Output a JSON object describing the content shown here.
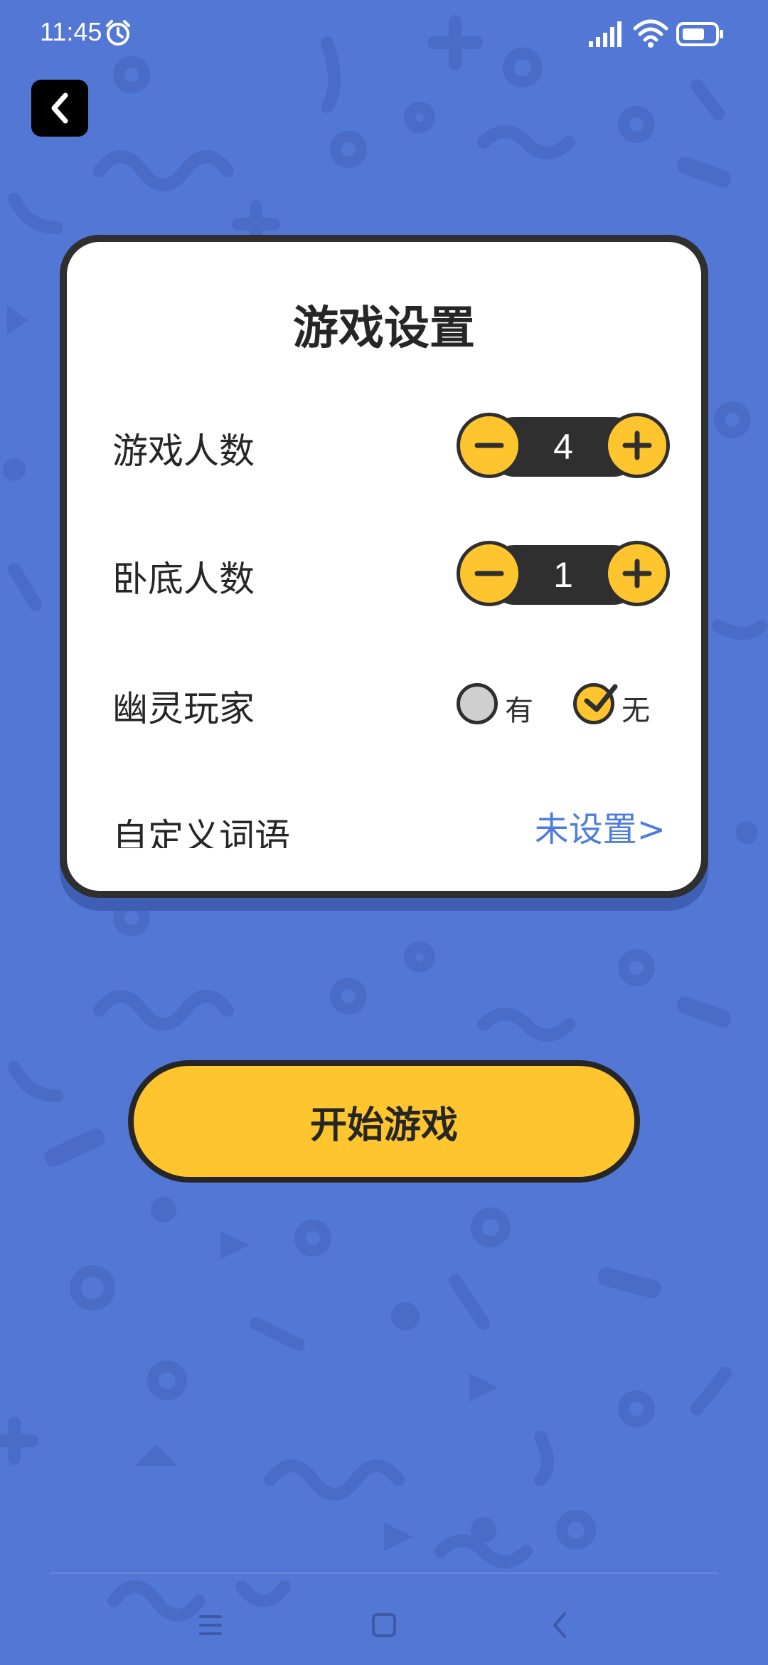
{
  "status_bar": {
    "time": "11:45"
  },
  "icons": {
    "back": "chevron-left-icon",
    "alarm": "alarm-clock-icon",
    "signal": "signal-icon",
    "wifi": "wifi-icon",
    "battery": "battery-icon"
  },
  "colors": {
    "background": "#5277d4",
    "accent_yellow": "#ffc52e",
    "dark": "#2f2f2f",
    "link_blue": "#4f7ddb"
  },
  "card": {
    "title": "游戏设置",
    "player_count": {
      "label": "游戏人数",
      "value": "4"
    },
    "undercover_count": {
      "label": "卧底人数",
      "value": "1"
    },
    "ghost_player": {
      "label": "幽灵玩家",
      "options": [
        {
          "label": "有",
          "selected": false
        },
        {
          "label": "无",
          "selected": true
        }
      ]
    },
    "custom_words": {
      "label": "自定义词语",
      "link": "未设置>"
    }
  },
  "start_button": {
    "label": "开始游戏"
  }
}
